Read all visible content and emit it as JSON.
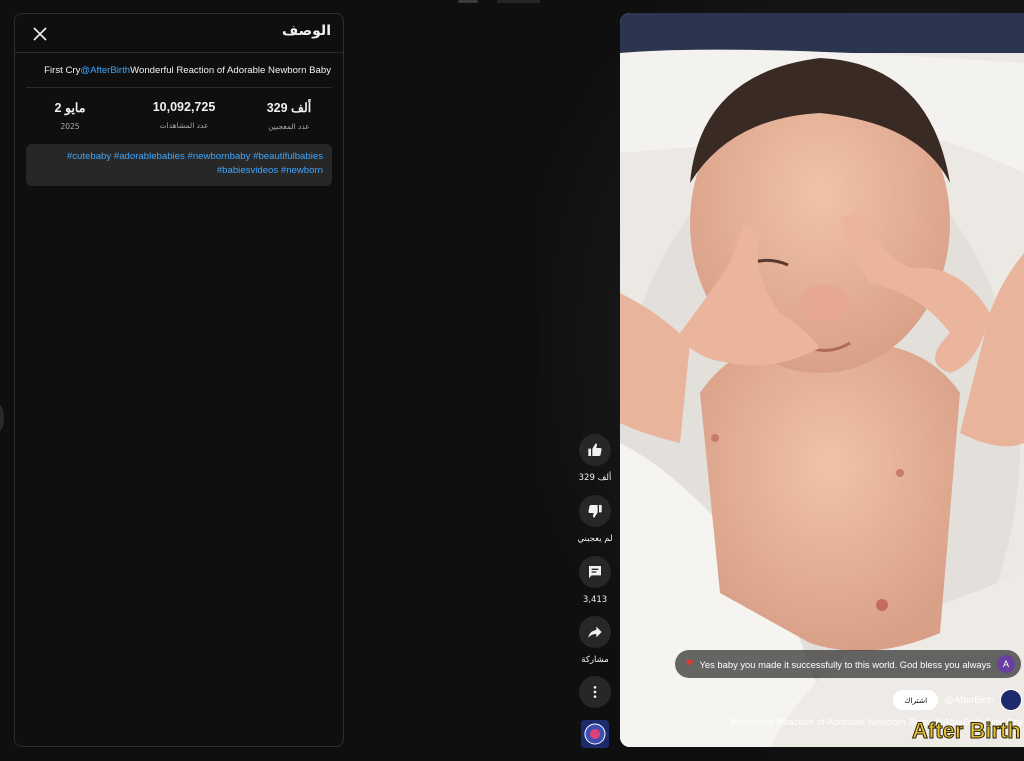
{
  "description_panel": {
    "title": "الوصف",
    "video_title_prefix": "First Cry",
    "video_title_handle": "@AfterBirth",
    "video_title_rest": "Wonderful Reaction of Adorable Newborn Baby",
    "stats": {
      "likes_value": "329 ألف",
      "likes_label": "عدد المعجبين",
      "views_value": "10,092,725",
      "views_label": "عدد المشاهدات",
      "date_value": "2 مايو",
      "date_year": "2025"
    },
    "hashtags": [
      "#cutebaby",
      "#adorablebabies",
      "#newbornbaby",
      "#beautifulbabies",
      "#babiesvideos",
      "#newborn"
    ]
  },
  "actions": {
    "like_count": "329 ألف",
    "dislike_label": "لم يعجبني",
    "comment_count": "3,413",
    "share_label": "مشاركة"
  },
  "video_overlay": {
    "comment_avatar_letter": "A",
    "comment_text": "Yes baby you made it successfully to this world. God bless you always",
    "subscribe_label": "اشتراك",
    "channel_handle": "@AfterBirth",
    "caption": "Wonderful Reaction of Adorable Newborn Baby @AfterBirth First Cry",
    "watermark_text": "After Birth"
  },
  "colors": {
    "background": "#0f0f0f",
    "link": "#3ea6ff",
    "chip_bg": "#272727",
    "watermark": "#e6c43a"
  }
}
